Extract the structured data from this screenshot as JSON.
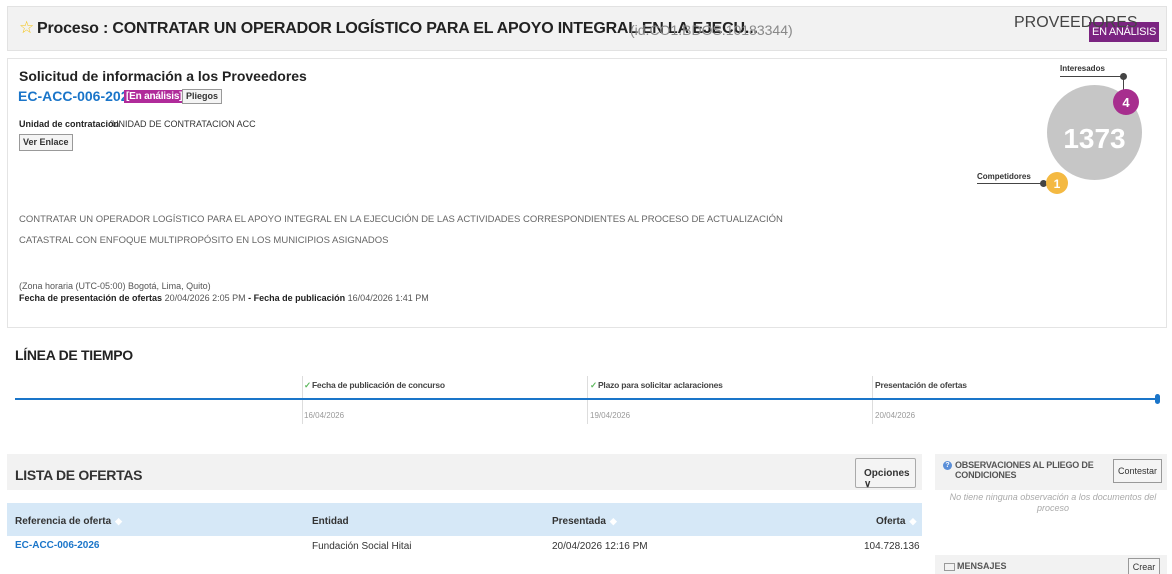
{
  "header": {
    "title": "Proceso : CONTRATAR UN OPERADOR LOGÍSTICO PARA EL APOYO INTEGRAL EN LA EJECU...",
    "process_id": "(id.CO1.BDOS.10183344)",
    "status_badge": "EN ANÁLISIS"
  },
  "info": {
    "rfi_title": "Solicitud de información a los Proveedores",
    "reference": "EC-ACC-006-2026",
    "inline_status": "[En análisis]",
    "pliegos_label": "Pliegos",
    "unit_label": "Unidad de contratación",
    "unit_value": "UNIDAD DE CONTRATACION ACC",
    "ver_enlace_label": "Ver Enlace",
    "description": "CONTRATAR UN OPERADOR LOGÍSTICO PARA EL APOYO INTEGRAL EN LA EJECUCIÓN DE LAS ACTIVIDADES CORRESPONDIENTES AL PROCESO DE ACTUALIZACIÓN CATASTRAL CON ENFOQUE MULTIPROPÓSITO EN LOS MUNICIPIOS ASIGNADOS",
    "timezone": "(Zona horaria (UTC-05:00) Bogotá, Lima, Quito)",
    "offer_date_label": "Fecha de presentación de ofertas",
    "offer_date_value": "20/04/2026 2:05 PM",
    "separator": " - ",
    "publish_date_label": "Fecha de publicación",
    "publish_date_value": "16/04/2026 1:41 PM"
  },
  "providers": {
    "title": "PROVEEDORES",
    "total": "1373",
    "interested_label": "Interesados",
    "interested_count": "4",
    "competitors_label": "Competidores",
    "competitors_count": "1",
    "colors": {
      "total": "#c6c6c6",
      "interested": "#a72e8e",
      "competitors": "#f4b942"
    }
  },
  "timeline": {
    "title": "LÍNEA DE TIEMPO",
    "milestones": [
      {
        "label": "Fecha de publicación de concurso",
        "date": "16/04/2026",
        "completed": true
      },
      {
        "label": "Plazo para solicitar aclaraciones",
        "date": "19/04/2026",
        "completed": true
      },
      {
        "label": "Presentación de ofertas",
        "date": "20/04/2026",
        "completed": false
      }
    ]
  },
  "offers": {
    "title": "LISTA DE OFERTAS",
    "options_label": "Opciones",
    "columns": [
      "Referencia de oferta",
      "Entidad",
      "Presentada",
      "Oferta"
    ],
    "rows": [
      {
        "ref": "EC-ACC-006-2026",
        "entity": "Fundación Social Hitai",
        "submitted": "20/04/2026 12:16 PM",
        "amount": "104.728.136"
      }
    ]
  },
  "observations": {
    "title": "OBSERVACIONES AL PLIEGO DE CONDICIONES",
    "button_label": "Contestar",
    "empty_text": "No tiene ninguna observación a los documentos del proceso"
  },
  "messages": {
    "title": "MENSAJES",
    "button_label": "Crear"
  }
}
